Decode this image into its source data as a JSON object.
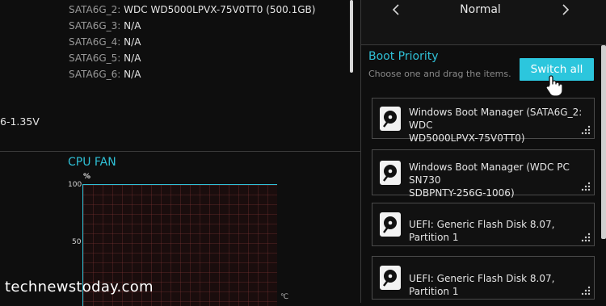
{
  "storage": {
    "rows": [
      {
        "label": "SATA6G_2:",
        "value": "WDC WD5000LPVX-75V0TT0 (500.1GB)"
      },
      {
        "label": "SATA6G_3:",
        "value": "N/A"
      },
      {
        "label": "SATA6G_4:",
        "value": "N/A"
      },
      {
        "label": "SATA6G_5:",
        "value": "N/A"
      },
      {
        "label": "SATA6G_6:",
        "value": "N/A"
      }
    ]
  },
  "voltage_partial": "6-1.35V",
  "cpu_fan": {
    "title": "CPU FAN",
    "y_unit": "%",
    "x_unit": "℃",
    "ticks": [
      "100",
      "50"
    ]
  },
  "mode_selector": {
    "value": "Normal",
    "prev_icon": "chevron-left-icon",
    "next_icon": "chevron-right-icon"
  },
  "boot_priority": {
    "title": "Boot Priority",
    "subtitle": "Choose one and drag the items.",
    "switch_all_label": "Switch all",
    "items": [
      {
        "line1": "Windows Boot Manager (SATA6G_2: WDC",
        "line2": "WD5000LPVX-75V0TT0)"
      },
      {
        "line1": "Windows Boot Manager (WDC PC SN730",
        "line2": "SDBPNTY-256G-1006)"
      },
      {
        "line1": "UEFI: Generic Flash Disk 8.07, Partition 1",
        "line2": ""
      },
      {
        "line1": "UEFI: Generic Flash Disk 8.07, Partition 1",
        "line2": ""
      }
    ]
  },
  "watermark": "technewstoday.com",
  "colors": {
    "accent": "#2fc0d6",
    "button": "#2cc6dd",
    "background": "#0e0e0e"
  }
}
